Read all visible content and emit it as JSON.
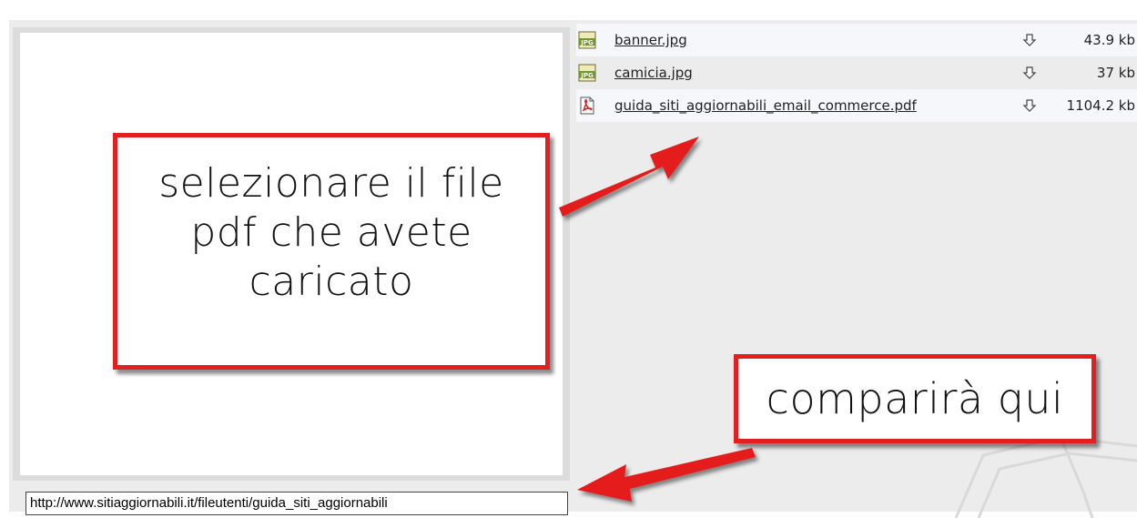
{
  "files": [
    {
      "name": "banner.jpg",
      "size": "43.9 kb",
      "icon": "jpg-file-icon"
    },
    {
      "name": "camicia.jpg",
      "size": "37 kb",
      "icon": "jpg-file-icon"
    },
    {
      "name": "guida_siti_aggiornabili_email_commerce.pdf",
      "size": "1104.2 kb",
      "icon": "pdf-file-icon"
    }
  ],
  "callout_select": {
    "line1": "selezionare il file",
    "line2": "pdf che avete",
    "line3": "caricato"
  },
  "callout_appear": {
    "text": "comparirà qui"
  },
  "url_field": {
    "value": "http://www.sitiaggiornabili.it/fileutenti/guida_siti_aggiornabili"
  },
  "colors": {
    "callout_border": "#e41f1f",
    "arrow": "#e41f1f",
    "panel_background": "#ececec"
  }
}
